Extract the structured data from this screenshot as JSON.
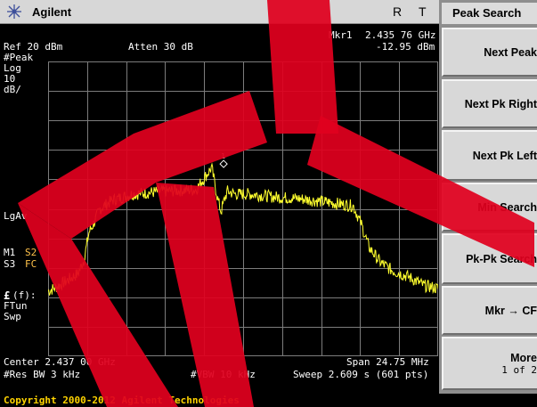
{
  "title_bar": {
    "brand": "Agilent",
    "flag_r": "R",
    "flag_t": "T"
  },
  "menu": {
    "title": "Peak Search",
    "keys": [
      {
        "label": "Next Peak"
      },
      {
        "label": "Next Pk Right"
      },
      {
        "label": "Next Pk Left"
      },
      {
        "label": "Min Search"
      },
      {
        "label": "Pk-Pk Search"
      },
      {
        "label": "Mkr → CF"
      },
      {
        "label": "More",
        "sub": "1 of 2"
      }
    ]
  },
  "marker": {
    "readout_name": "Mkr1",
    "frequency": "2.435 76 GHz",
    "amplitude": "-12.95 dBm",
    "symbol_label": "1"
  },
  "settings": {
    "ref_level": "Ref 20 dBm",
    "attenuation": "Atten 30 dB",
    "detector": "#Peak",
    "scale_type": "Log",
    "scale_value": "10",
    "scale_unit": "dB/",
    "averaging": "LgAv",
    "m1_label": "M1",
    "s2_label": "S2",
    "s3_label": "S3",
    "fc_label": "FC",
    "correction_symbol": "£",
    "correction_arg": "(f):",
    "ftun": "FTun",
    "swp": "Swp"
  },
  "bottom": {
    "center": "Center 2.437 00 GHz",
    "span": "Span 24.75 MHz",
    "res_bw": "#Res BW 3 kHz",
    "vbw": "#VBW 10 kHz",
    "sweep": "Sweep 2.609 s (601 pts)"
  },
  "copyright": "Copyright 2000-2012 Agilent Technologies",
  "colors": {
    "trace": "#ffff2e",
    "watermark": "#e0001e",
    "grid": "#7c7c7c"
  },
  "chart_data": {
    "type": "line",
    "x_unit": "GHz",
    "y_unit": "dBm",
    "xlim": [
      2.4246,
      2.4494
    ],
    "ylim": [
      -80,
      20
    ],
    "grid": true,
    "series": [
      {
        "x": [
          2.4246,
          2.4253,
          2.4259,
          2.4265,
          2.4269,
          2.4272,
          2.4275,
          2.4279,
          2.4287,
          2.43,
          2.432,
          2.434,
          2.435,
          2.4354,
          2.4356,
          2.4358,
          2.436,
          2.4365,
          2.4375,
          2.439,
          2.4405,
          2.442,
          2.444,
          2.4445,
          2.445,
          2.4457,
          2.4465,
          2.4475,
          2.4485,
          2.4494
        ],
        "y": [
          -58,
          -56,
          -54,
          -52,
          -47,
          -38,
          -35,
          -30,
          -27,
          -25,
          -24,
          -23.5,
          -16,
          -27,
          -31,
          -27,
          -24,
          -25,
          -25,
          -26,
          -26.5,
          -27.5,
          -29,
          -35,
          -43,
          -48,
          -51,
          -53,
          -56,
          -57
        ]
      }
    ],
    "marker": {
      "x": 2.43576,
      "y": -12.95
    }
  }
}
